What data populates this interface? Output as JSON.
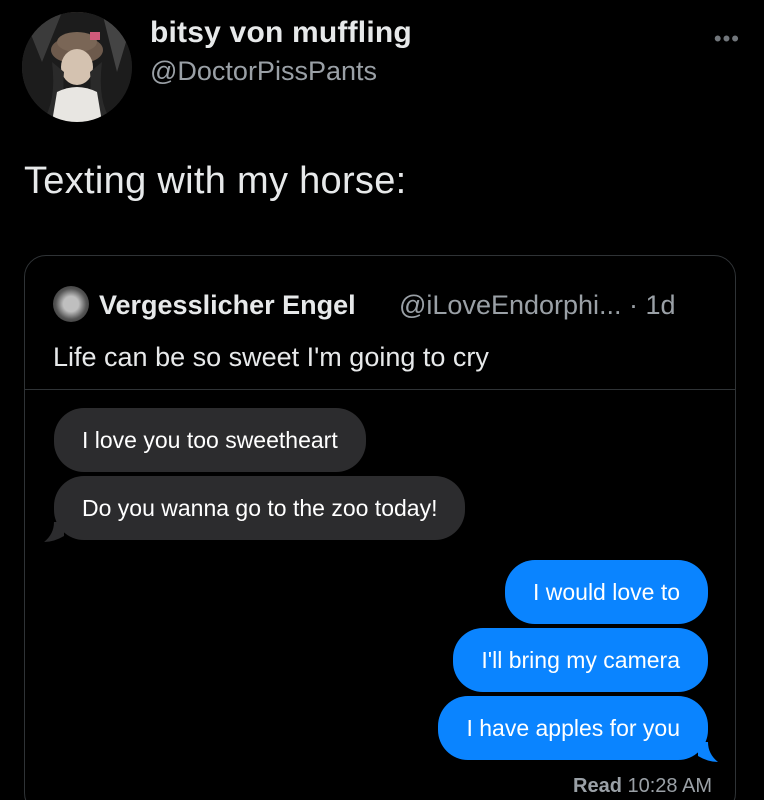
{
  "tweet": {
    "display_name": "bitsy von muffling",
    "handle": "@DoctorPissPants",
    "more_icon": "more-horizontal-icon",
    "text": "Texting with my horse:"
  },
  "quoted_tweet": {
    "name": "Vergesslicher Engel",
    "meta": "@iLoveEndorphi... · 1d",
    "text": "Life can be so sweet I'm going to cry"
  },
  "messages": [
    {
      "direction": "incoming",
      "text": "I love you too sweetheart"
    },
    {
      "direction": "incoming",
      "text": "Do you wanna go to the zoo today!"
    },
    {
      "direction": "outgoing",
      "text": "I would love to"
    },
    {
      "direction": "outgoing",
      "text": "I'll bring my camera"
    },
    {
      "direction": "outgoing",
      "text": "I have apples for you"
    }
  ],
  "read_receipt": {
    "label": "Read",
    "time": "10:28 AM"
  },
  "colors": {
    "background": "#000000",
    "incoming_bubble": "#2c2c2e",
    "outgoing_bubble": "#0a84ff"
  }
}
